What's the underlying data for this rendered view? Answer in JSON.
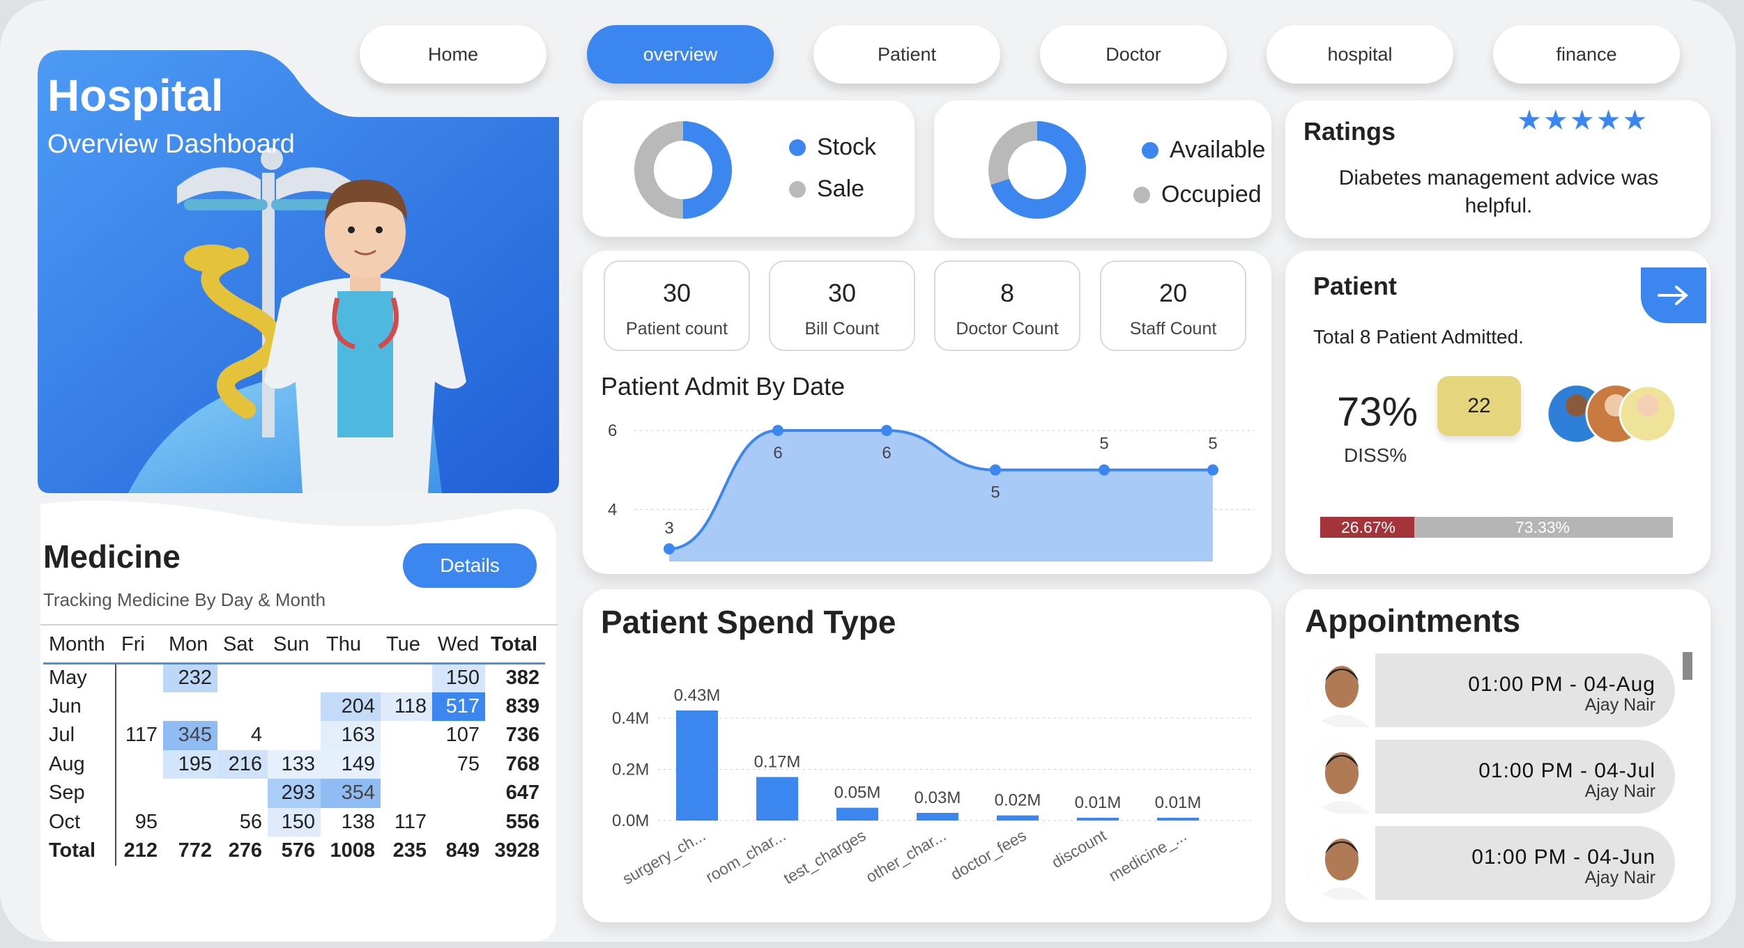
{
  "nav": [
    "Home",
    "overview",
    "Patient",
    "Doctor",
    "hospital",
    "finance"
  ],
  "hero": {
    "title": "Hospital",
    "subtitle": "Overview Dashboard"
  },
  "stock_donut": {
    "legend": [
      "Stock",
      "Sale"
    ],
    "colors": [
      "#3b87ef",
      "#b9b9b9"
    ],
    "share_blue": 0.5
  },
  "bed_donut": {
    "legend": [
      "Available",
      "Occupied"
    ],
    "colors": [
      "#3b87ef",
      "#b9b9b9"
    ],
    "share_blue": 0.7
  },
  "ratings": {
    "title": "Ratings",
    "stars": "★★★★★",
    "text": "Diabetes management advice was helpful."
  },
  "kpis": [
    {
      "value": "30",
      "label": "Patient  count"
    },
    {
      "value": "30",
      "label": "Bill Count"
    },
    {
      "value": "8",
      "label": "Doctor Count"
    },
    {
      "value": "20",
      "label": "Staff Count"
    }
  ],
  "patient_panel": {
    "title": "Patient",
    "subtitle": "Total 8 Patient Admitted.",
    "pct": "73%",
    "pct_label": "DISS%",
    "badge": "22",
    "bar": {
      "left_label": "26.67%",
      "right_label": "73.33%",
      "left_share": 0.2667
    }
  },
  "medicine": {
    "title": "Medicine",
    "subtitle": "Tracking Medicine By Day & Month",
    "details_label": "Details",
    "columns": [
      "Month",
      "Fri",
      "Mon",
      "Sat",
      "Sun",
      "Thu",
      "Tue",
      "Wed",
      "Total"
    ],
    "rows": [
      [
        "May",
        "",
        "232",
        "",
        "",
        "",
        "",
        "150",
        "382"
      ],
      [
        "Jun",
        "",
        "",
        "",
        "",
        "204",
        "118",
        "517",
        "839"
      ],
      [
        "Jul",
        "117",
        "345",
        "4",
        "",
        "163",
        "",
        "107",
        "736"
      ],
      [
        "Aug",
        "",
        "195",
        "216",
        "133",
        "149",
        "",
        "75",
        "768"
      ],
      [
        "Sep",
        "",
        "",
        "",
        "293",
        "354",
        "",
        "",
        "647"
      ],
      [
        "Oct",
        "95",
        "",
        "56",
        "150",
        "138",
        "117",
        "",
        "556"
      ]
    ],
    "total_row": [
      "Total",
      "212",
      "772",
      "276",
      "576",
      "1008",
      "235",
      "849",
      "3928"
    ]
  },
  "appointments": {
    "title": "Appointments",
    "items": [
      {
        "time": "01:00 PM - 04-Aug",
        "name": "Ajay Nair"
      },
      {
        "time": "01:00 PM - 04-Jul",
        "name": "Ajay Nair"
      },
      {
        "time": "01:00 PM - 04-Jun",
        "name": "Ajay Nair"
      }
    ]
  },
  "chart_data": [
    {
      "type": "area",
      "title": "Patient Admit By Date",
      "x": [
        "",
        "",
        "",
        "",
        "",
        ""
      ],
      "values": [
        3,
        6,
        6,
        5,
        5,
        5
      ],
      "ylim": [
        3,
        6
      ],
      "yticks": [
        4,
        6
      ],
      "grid": true,
      "color": "#3b87ef"
    },
    {
      "type": "bar",
      "title": "Patient Spend Type",
      "categories": [
        "surgery_ch...",
        "room_char...",
        "test_charges",
        "other_char...",
        "doctor_fees",
        "discount",
        "medicine_..."
      ],
      "values": [
        430000,
        170000,
        50000,
        30000,
        20000,
        10000,
        10000
      ],
      "data_labels": [
        "0.43M",
        "0.17M",
        "0.05M",
        "0.03M",
        "0.02M",
        "0.01M",
        "0.01M"
      ],
      "yticks": [
        "0.0M",
        "0.2M",
        "0.4M"
      ],
      "ylim": [
        0,
        430000
      ],
      "grid": true,
      "color": "#3b87ef"
    }
  ]
}
